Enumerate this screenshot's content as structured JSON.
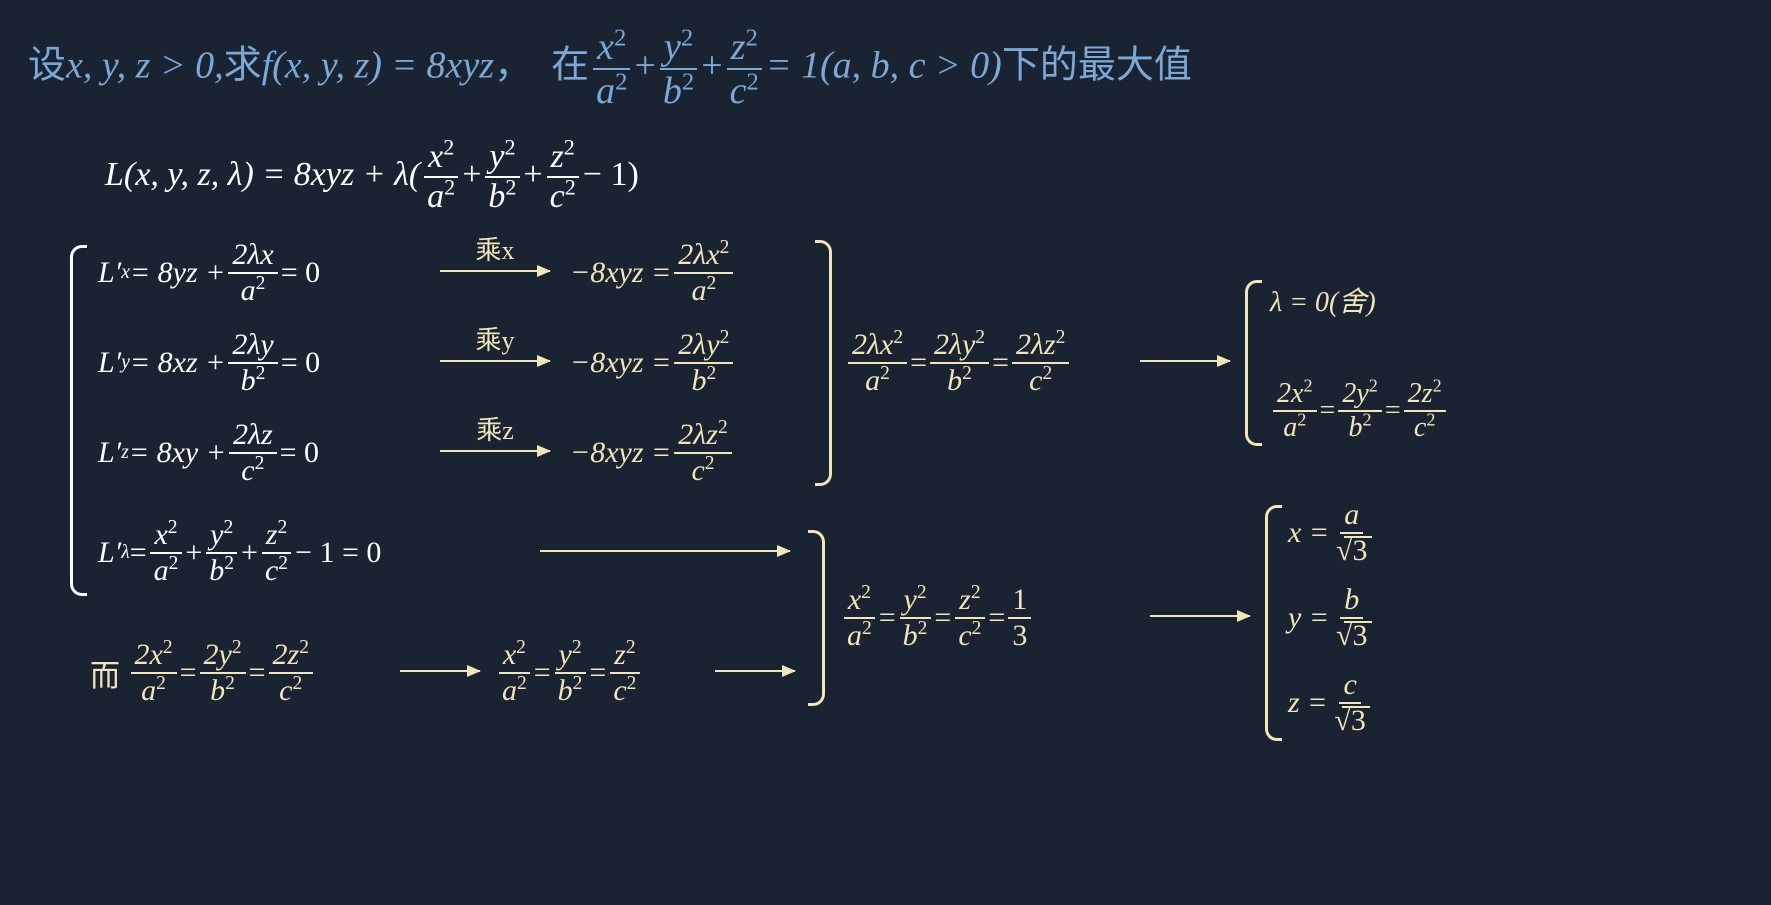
{
  "problem": {
    "pre": "设",
    "cond": "x, y, z  > 0,",
    "qiu": "求",
    "f": "f(x, y, z) = 8xyz",
    "comma": "，",
    "zai": "在",
    "eq1": "= 1(a, b, c  > 0)",
    "tail": "下的最大值"
  },
  "lagrangian": {
    "L": "L(x, y, z, λ) = 8xyz + λ(",
    "minus1": "− 1)"
  },
  "system": {
    "Lx": "L′",
    "eq_x": " = 8yz + ",
    "eq_y": " = 8xz + ",
    "eq_z": " = 8xy + ",
    "eq0": " = 0",
    "Llam": " − 1 = 0",
    "mul_x": "乘x",
    "mul_y": "乘y",
    "mul_z": "乘z",
    "neg8": "−8xyz = ",
    "chain_eq": " = ",
    "lambda0": "λ = 0(舍)",
    "er": "而",
    "onethird": "1",
    "three": "3",
    "x_sol": "x = ",
    "y_sol": "y = ",
    "z_sol": "z = ",
    "sqrt3": "√3",
    "a": "a",
    "b": "b",
    "c": "c"
  },
  "frac": {
    "x2": "x",
    "y2": "y",
    "z2": "z",
    "a2": "a",
    "b2": "b",
    "c2": "c",
    "2lx": "2λx",
    "2ly": "2λy",
    "2lz": "2λz",
    "2lx2": "2λx",
    "2ly2": "2λy",
    "2lz2": "2λz",
    "2x2": "2x",
    "2y2": "2y",
    "2z2": "2z"
  }
}
